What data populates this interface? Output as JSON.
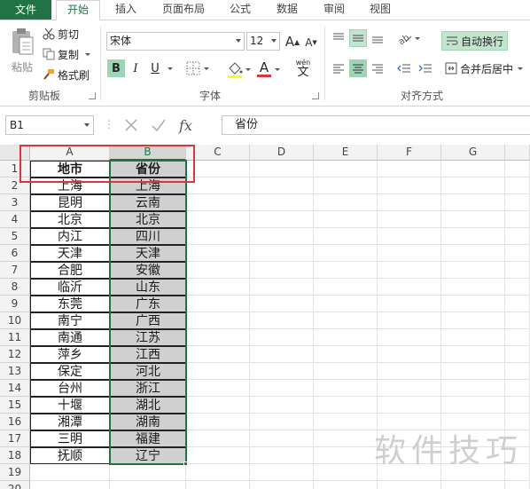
{
  "tabs": [
    "文件",
    "开始",
    "插入",
    "页面布局",
    "公式",
    "数据",
    "审阅",
    "视图"
  ],
  "ribbon": {
    "clipboard": {
      "paste": "粘贴",
      "cut": "剪切",
      "copy": "复制",
      "format_painter": "格式刷",
      "group_label": "剪贴板"
    },
    "font": {
      "font_name": "宋体",
      "font_size": "12",
      "bold": "B",
      "italic": "I",
      "underline": "U",
      "font_color_glyph": "A",
      "phonetic": "wén",
      "group_label": "字体",
      "font_color": "#d9363e"
    },
    "alignment": {
      "wrap_text": "自动换行",
      "merge_center": "合并后居中",
      "group_label": "对齐方式"
    }
  },
  "formula_bar": {
    "name_box": "B1",
    "formula": "省份"
  },
  "columns": [
    "A",
    "B",
    "C",
    "D",
    "E",
    "F",
    "G"
  ],
  "rows": [
    [
      "地市",
      "省份"
    ],
    [
      "上海",
      "上海"
    ],
    [
      "昆明",
      "云南"
    ],
    [
      "北京",
      "北京"
    ],
    [
      "内江",
      "四川"
    ],
    [
      "天津",
      "天津"
    ],
    [
      "合肥",
      "安徽"
    ],
    [
      "临沂",
      "山东"
    ],
    [
      "东莞",
      "广东"
    ],
    [
      "南宁",
      "广西"
    ],
    [
      "南通",
      "江苏"
    ],
    [
      "萍乡",
      "江西"
    ],
    [
      "保定",
      "河北"
    ],
    [
      "台州",
      "浙江"
    ],
    [
      "十堰",
      "湖北"
    ],
    [
      "湘潭",
      "湖南"
    ],
    [
      "三明",
      "福建"
    ],
    [
      "抚顺",
      "辽宁"
    ],
    [
      "",
      ""
    ],
    [
      "",
      ""
    ]
  ],
  "watermark": "软件技巧",
  "colors": {
    "accent": "#217346",
    "highlight": "#9fd5b7",
    "annotation": "#d9363e"
  }
}
